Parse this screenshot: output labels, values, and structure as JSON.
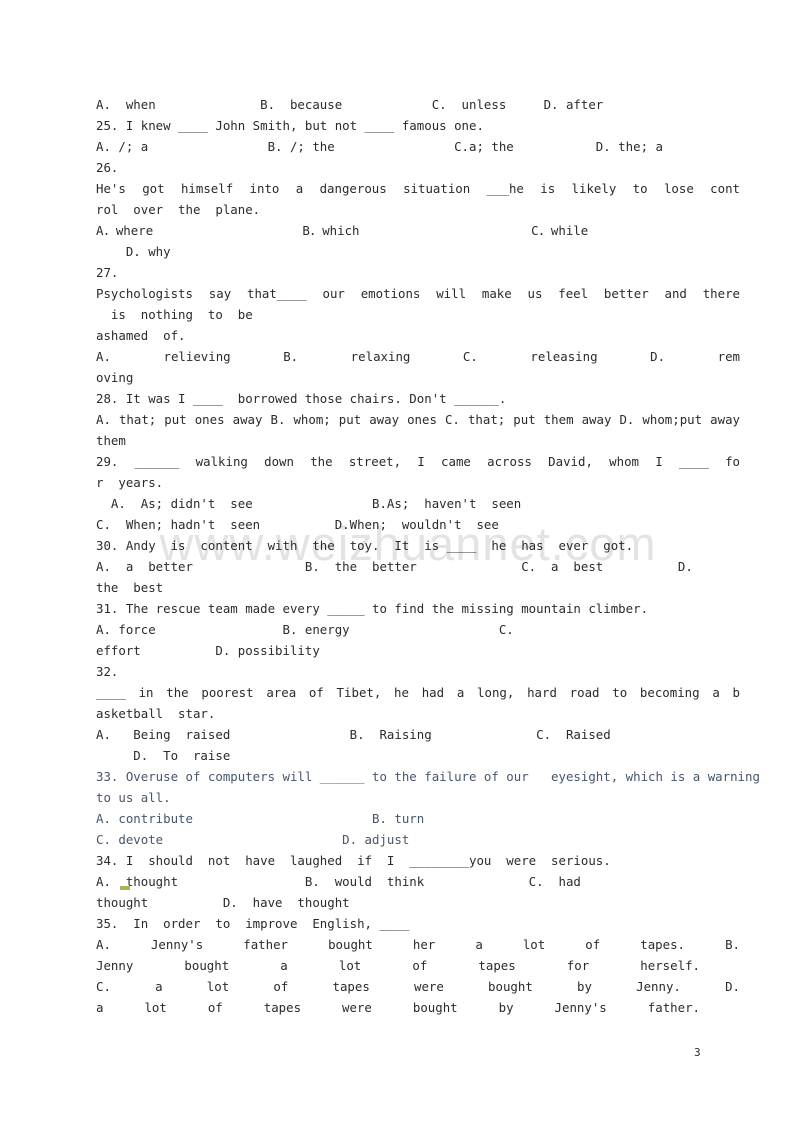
{
  "document": {
    "page_number": "3",
    "watermark": "www.weizhuannet.com"
  },
  "lines": [
    {
      "id": "l01",
      "text": "A.  when              B.  because            C.  unless     D. after"
    },
    {
      "id": "l02",
      "text": "25. I knew ____ John Smith, but not ____ famous one."
    },
    {
      "id": "l03",
      "text": "A. /; a                B. /; the                C.a; the           D. the; a"
    },
    {
      "id": "l04",
      "text": "26."
    },
    {
      "id": "l05",
      "text": "He's  got  himself  into  a  dangerous  situation  ___he  is  likely  to  lose  cont"
    },
    {
      "id": "l06",
      "text": "rol  over  the  plane."
    },
    {
      "id": "l07",
      "text": "A．where                    B．which                       C．while"
    },
    {
      "id": "l08",
      "text": "    D. why"
    },
    {
      "id": "l09",
      "text": "27."
    },
    {
      "id": "l10",
      "text": "Psychologists  say  that____  our  emotions  will  make  us  feel  better  and  there"
    },
    {
      "id": "l11",
      "text": "  is  nothing  to  be"
    },
    {
      "id": "l12",
      "text": "ashamed  of."
    },
    {
      "id": "l13",
      "text": "  A.  relieving           B.  relaxing        C.  releasing          D.  rem"
    },
    {
      "id": "l14",
      "text": "oving"
    },
    {
      "id": "l15",
      "text": "28. It was I ____  borrowed those chairs. Don't ______."
    },
    {
      "id": "l16",
      "text": "A. that; put ones away B. whom; put away ones C. that; put them away  D. whom;put away"
    },
    {
      "id": "l17",
      "text": "them"
    },
    {
      "id": "l18",
      "text": "29.  ______  walking  down  the  street,  I  came  across  David,  whom  I  ____  fo"
    },
    {
      "id": "l19",
      "text": "r  years."
    },
    {
      "id": "l20",
      "text": "  A.  As; didn't  see                B.As;  haven't  seen"
    },
    {
      "id": "l21",
      "text": "C.  When; hadn't  seen          D.When;  wouldn't  see"
    },
    {
      "id": "l22",
      "text": "30. Andy  is  content  with  the  toy.  It  is ____  he  has  ever  got."
    },
    {
      "id": "l23",
      "text": "A.  a  better               B.  the  better              C.  a  best          D."
    },
    {
      "id": "l24",
      "text": "the  best"
    },
    {
      "id": "l25",
      "text": "31. The rescue team made every _____ to find the missing mountain climber."
    },
    {
      "id": "l26",
      "text": "A. force                 B. energy                    C."
    },
    {
      "id": "l27",
      "text": "effort          D. possibility"
    },
    {
      "id": "l28",
      "text": "32."
    },
    {
      "id": "l29",
      "text": "____  in  the  poorest  area  of  Tibet,  he  had  a  long,  hard  road  to  becoming  a  b"
    },
    {
      "id": "l30",
      "text": "asketball  star."
    },
    {
      "id": "l31",
      "text": "A.   Being  raised                B.  Raising              C.  Raised"
    },
    {
      "id": "l32",
      "text": "     D.  To  raise"
    },
    {
      "id": "l33",
      "text": "33. Overuse of computers will ______ to the failure of our   eyesight, which is a warning",
      "color": "blue"
    },
    {
      "id": "l34",
      "text": "to us all.",
      "color": "blue"
    },
    {
      "id": "l35",
      "text": "A. contribute                        B. turn",
      "color": "blue"
    },
    {
      "id": "l36",
      "text": "C. devote                        D. adjust",
      "color": "blue"
    },
    {
      "id": "l37",
      "text": "34. I  should  not  have  laughed  if  I  ________you  were  serious."
    },
    {
      "id": "l38",
      "text": "A.  thought                 B.  would  think              C.  had"
    },
    {
      "id": "l39",
      "text": "thought          D.  have  thought"
    },
    {
      "id": "l40",
      "text": "35.  In  order  to  improve  English, ____"
    },
    {
      "id": "l41",
      "text": "A.          Jenny's  father  bought  her  a  lot  of  tapes.                B."
    },
    {
      "id": "l42",
      "text": "Jenny  bought  a  lot  of  tapes  for  herself."
    },
    {
      "id": "l43",
      "text": "C.       a  lot  of  tapes  were  bought  by  Jenny.                       D."
    },
    {
      "id": "l44",
      "text": "a  lot  of  tapes  were  bought  by  Jenny's  father."
    }
  ],
  "questions": [
    {
      "number": "25",
      "stem": "I knew ____ John Smith, but not ____ famous one.",
      "options": [
        "A. /; a",
        "B. /; the",
        "C.a; the",
        "D. the; a"
      ]
    },
    {
      "number": "26",
      "stem": "He's got himself into a dangerous situation ___he is likely to lose control over the plane.",
      "options": [
        "A．where",
        "B．which",
        "C．while",
        "D. why"
      ]
    },
    {
      "number": "27",
      "stem": "Psychologists say that____ our emotions will make us feel better and there is nothing to be ashamed of.",
      "options": [
        "A. relieving",
        "B. relaxing",
        "C. releasing",
        "D. removing"
      ]
    },
    {
      "number": "28",
      "stem": "It was I ____ borrowed those chairs. Don't ______.",
      "options": [
        "A. that; put ones away",
        "B. whom; put away ones",
        "C. that; put them away",
        "D. whom;put away them"
      ]
    },
    {
      "number": "29",
      "stem": "______ walking down the street, I came across David, whom I ____ for years.",
      "options": [
        "A. As; didn't see",
        "B.As; haven't seen",
        "C. When; hadn't seen",
        "D.When; wouldn't see"
      ]
    },
    {
      "number": "30",
      "stem": "Andy is content with the toy. It is ____ he has ever got.",
      "options": [
        "A. a better",
        "B. the better",
        "C. a best",
        "D. the best"
      ]
    },
    {
      "number": "31",
      "stem": "The rescue team made every _____ to find the missing mountain climber.",
      "options": [
        "A. force",
        "B. energy",
        "C. effort",
        "D. possibility"
      ]
    },
    {
      "number": "32",
      "stem": "____ in the poorest area of Tibet, he had a long, hard road to becoming a basketball star.",
      "options": [
        "A. Being raised",
        "B. Raising",
        "C. Raised",
        "D. To raise"
      ]
    },
    {
      "number": "33",
      "stem": "Overuse of computers will ______ to the failure of our eyesight, which is a warning to us all.",
      "options": [
        "A. contribute",
        "B. turn",
        "C. devote",
        "D. adjust"
      ]
    },
    {
      "number": "34",
      "stem": "I should not have laughed if I ________you were serious.",
      "options": [
        "A. thought",
        "B. would think",
        "C. had thought",
        "D. have thought"
      ]
    },
    {
      "number": "35",
      "stem": "In order to improve English, ____",
      "options": [
        "A. Jenny's father bought her a lot of tapes.",
        "B. Jenny bought a lot of tapes for herself.",
        "C. a lot of tapes were bought by Jenny.",
        "D. a lot of tapes were bought by Jenny's father."
      ]
    }
  ]
}
